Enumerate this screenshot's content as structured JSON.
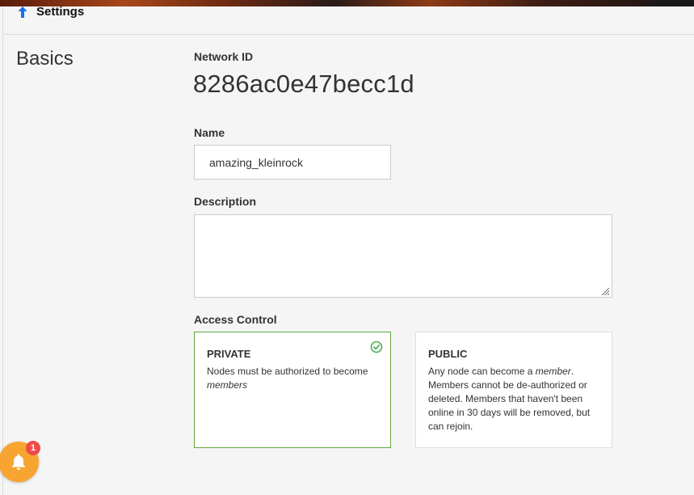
{
  "header": {
    "title": "Settings",
    "back_icon": "up-arrow-icon"
  },
  "basics": {
    "section_title": "Basics",
    "network_id_label": "Network ID",
    "network_id": "8286ac0e47becc1d",
    "name_label": "Name",
    "name_value": "amazing_kleinrock",
    "description_label": "Description",
    "description_value": "",
    "access_control_label": "Access Control"
  },
  "access_control": {
    "private": {
      "title": "PRIVATE",
      "desc_prefix": "Nodes must be authorized to become ",
      "desc_em": "members",
      "selected": true
    },
    "public": {
      "title": "PUBLIC",
      "desc_prefix": "Any node can become a ",
      "desc_em": "member",
      "desc_suffix": ". Members cannot be de-authorized or deleted. Members that haven't been online in 30 days will be removed, but can rejoin.",
      "selected": false
    }
  },
  "notifications": {
    "icon": "bell-icon",
    "count": "1"
  },
  "colors": {
    "accent_blue": "#1a73e8",
    "selected_border": "#5fa83a",
    "check_green": "#4caf50",
    "bell_orange": "#f7a530",
    "badge_red": "#ef4a4a"
  }
}
